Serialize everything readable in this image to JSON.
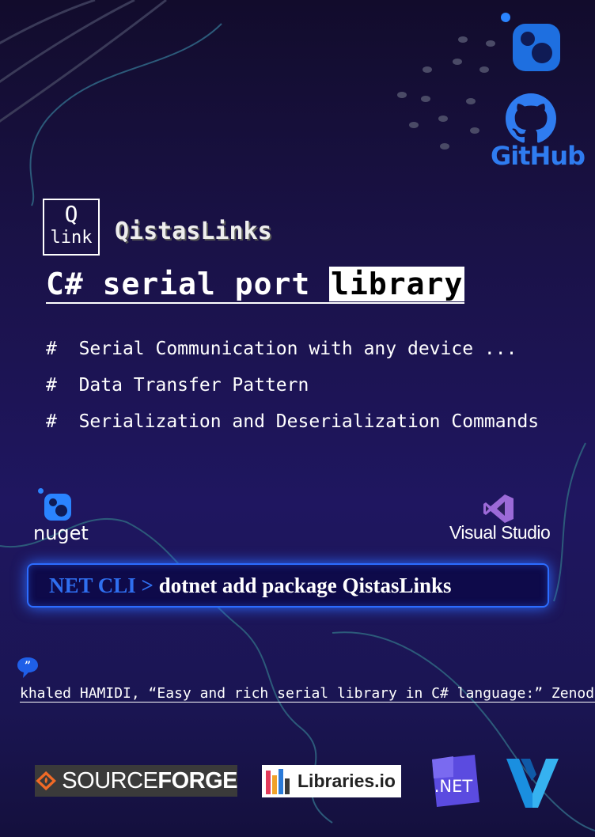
{
  "brand": {
    "logo_top": "Q",
    "logo_bottom": "link",
    "name": "QistasLinks"
  },
  "headline": {
    "prefix": "C# serial port ",
    "highlight": "library"
  },
  "features": [
    {
      "bullet": "#",
      "text": "Serial Communication with any device ..."
    },
    {
      "bullet": "#",
      "text": "Data Transfer Pattern"
    },
    {
      "bullet": "#",
      "text": "Serialization and Deserialization Commands"
    }
  ],
  "logos": {
    "top_right": {
      "icon": "nuget-icon"
    },
    "github": {
      "icon": "github-icon",
      "label": "GitHub"
    },
    "nuget": {
      "icon": "nuget-icon",
      "label": "nuget"
    },
    "visual_studio": {
      "icon": "visual-studio-icon",
      "label": "Visual Studio"
    }
  },
  "cli": {
    "prefix": "NET CLI",
    "arrow": " > ",
    "command": "dotnet add package QistasLinks"
  },
  "citation": {
    "icon": "quote-icon",
    "text": "khaled HAMIDI, “Easy and rich serial library in C# language:” Zenodo."
  },
  "footer": {
    "sourceforge_a": "SOURCE",
    "sourceforge_b": "FORGE",
    "libraries": "Libraries.io",
    "dotnet": ".NET"
  },
  "colors": {
    "background": "#1a1248",
    "accent_blue": "#2f6ff0",
    "github_blue": "#2f7cf0",
    "vs_purple": "#9c6ad8"
  }
}
